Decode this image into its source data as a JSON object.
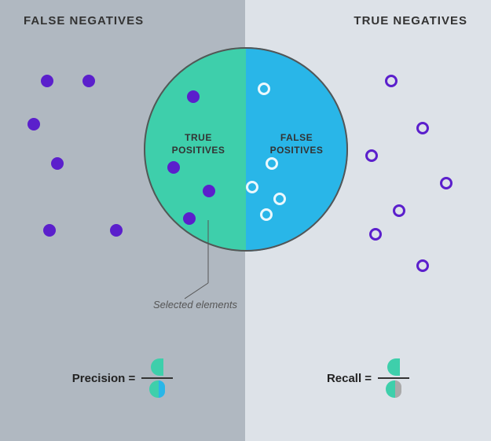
{
  "labels": {
    "false_negatives": "FALSE NEGATIVES",
    "true_negatives": "TRUE NEGATIVES",
    "true_positives": "TRUE POSITIVES",
    "false_positives": "FALSE POSITIVES",
    "selected_elements": "Selected elements",
    "precision": "Precision =",
    "recall": "Recall ="
  },
  "colors": {
    "bg_left": "#b0b8c1",
    "bg_right": "#dde2e8",
    "circle_left": "#3ecfab",
    "circle_right": "#29b6e8",
    "dot_purple": "#5b1fcc",
    "dot_outline_white": "rgba(255,255,255,0.9)"
  }
}
